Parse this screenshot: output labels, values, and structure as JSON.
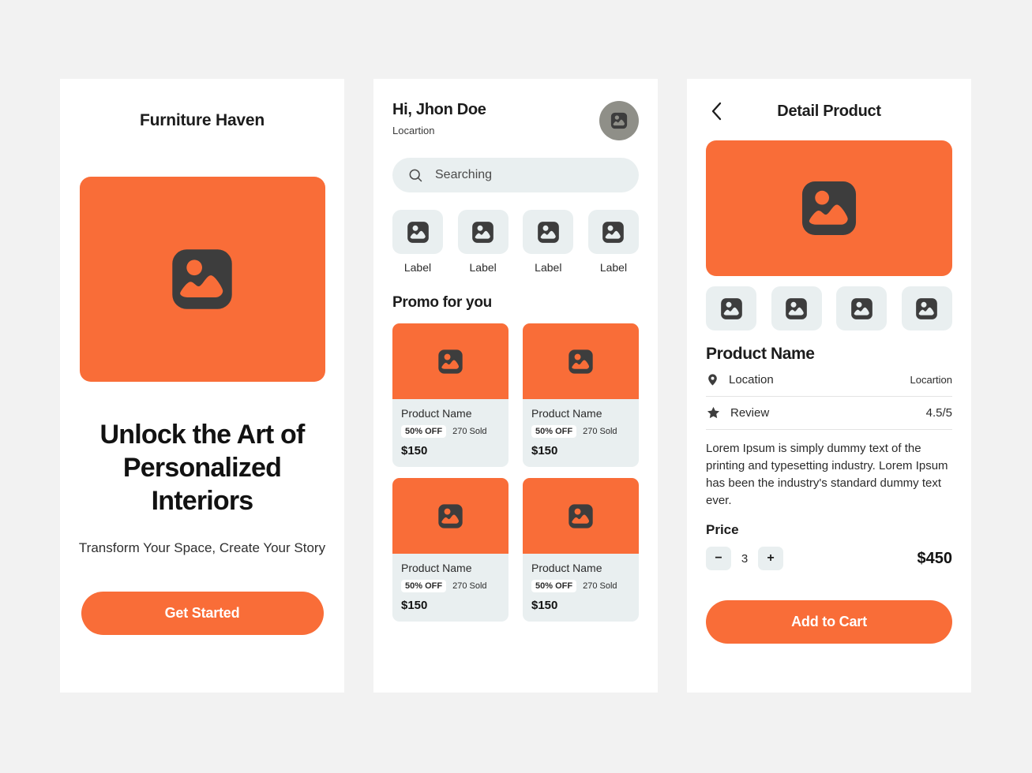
{
  "colors": {
    "accent": "#f96d38",
    "page_bg": "#f2f2f2",
    "screen_bg": "#ffffff",
    "tile_bg": "#e9eff0",
    "icon_dark": "#3d3d3d",
    "avatar_bg": "#8f8f88"
  },
  "onboarding": {
    "app_title": "Furniture Haven",
    "hero_icon": "image-placeholder-icon",
    "headline": "Unlock the Art of Personalized Interiors",
    "subheadline": "Transform Your Space, Create Your Story",
    "cta_label": "Get Started"
  },
  "home": {
    "greeting": "Hi, Jhon Doe",
    "location": "Locartion",
    "avatar_icon": "image-placeholder-icon",
    "search": {
      "icon": "search-icon",
      "placeholder": "Searching",
      "value": ""
    },
    "categories": [
      {
        "label": "Label",
        "icon": "image-placeholder-icon"
      },
      {
        "label": "Label",
        "icon": "image-placeholder-icon"
      },
      {
        "label": "Label",
        "icon": "image-placeholder-icon"
      },
      {
        "label": "Label",
        "icon": "image-placeholder-icon"
      }
    ],
    "section_title": "Promo for you",
    "products": [
      {
        "name": "Product Name",
        "discount": "50% OFF",
        "sold": "270 Sold",
        "price": "$150"
      },
      {
        "name": "Product Name",
        "discount": "50% OFF",
        "sold": "270 Sold",
        "price": "$150"
      },
      {
        "name": "Product Name",
        "discount": "50% OFF",
        "sold": "270 Sold",
        "price": "$150"
      },
      {
        "name": "Product Name",
        "discount": "50% OFF",
        "sold": "270 Sold",
        "price": "$150"
      }
    ]
  },
  "detail": {
    "back_icon": "chevron-left-icon",
    "title": "Detail Product",
    "hero_icon": "image-placeholder-icon",
    "thumbnails": [
      {
        "icon": "image-placeholder-icon"
      },
      {
        "icon": "image-placeholder-icon"
      },
      {
        "icon": "image-placeholder-icon"
      },
      {
        "icon": "image-placeholder-icon"
      }
    ],
    "product_name": "Product Name",
    "info_rows": [
      {
        "icon": "location-pin-icon",
        "label": "Location",
        "value": "Locartion"
      },
      {
        "icon": "star-icon",
        "label": "Review",
        "value": "4.5/5"
      }
    ],
    "description": "Lorem Ipsum is simply dummy text of the printing and typesetting industry. Lorem Ipsum has been the industry's standard dummy text ever.",
    "price_label": "Price",
    "stepper": {
      "decrement_label": "−",
      "quantity": "3",
      "increment_label": "+"
    },
    "total_price": "$450",
    "cta_label": "Add to Cart"
  }
}
